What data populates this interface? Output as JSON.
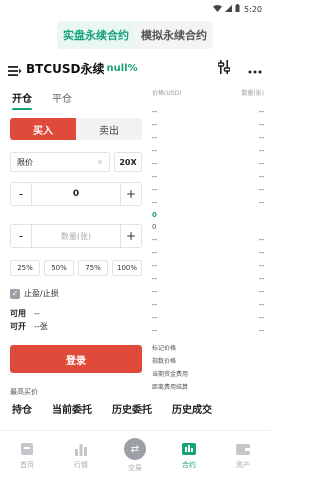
{
  "status": {
    "time": "5:20"
  },
  "top_switch": {
    "live": "实盘永续合约",
    "sim": "模拟永续合约"
  },
  "header": {
    "title": "BTCUSD永续",
    "change": "null%"
  },
  "tabs": {
    "open": "开仓",
    "close": "平仓"
  },
  "buysell": {
    "buy": "买入",
    "sell": "卖出"
  },
  "order_type": "限价",
  "order_type_x": "×",
  "leverage": "20X",
  "price": {
    "minus": "-",
    "value": "0",
    "plus": "+"
  },
  "qty": {
    "minus": "-",
    "placeholder": "数量(张)",
    "plus": "+"
  },
  "percents": [
    "25%",
    "50%",
    "75%",
    "100%"
  ],
  "stoploss_label": "止盈/止损",
  "available": {
    "label": "可用",
    "value": "--"
  },
  "open_qty": {
    "label": "可开",
    "value": "--张"
  },
  "login_label": "登录",
  "best_label": "最高买价",
  "orderbook": {
    "price_header": "价格(USD)",
    "qty_header": "数量(张)",
    "asks": [
      {
        "p": "--",
        "q": "--"
      },
      {
        "p": "--",
        "q": "--"
      },
      {
        "p": "--",
        "q": "--"
      },
      {
        "p": "--",
        "q": "--"
      },
      {
        "p": "--",
        "q": "--"
      },
      {
        "p": "--",
        "q": "--"
      },
      {
        "p": "--",
        "q": "--"
      },
      {
        "p": "--",
        "q": "--"
      }
    ],
    "last_price": "0",
    "mark_small": "0",
    "bids": [
      {
        "p": "--",
        "q": "--"
      },
      {
        "p": "--",
        "q": "--"
      },
      {
        "p": "--",
        "q": "--"
      },
      {
        "p": "--",
        "q": "--"
      },
      {
        "p": "--",
        "q": "--"
      },
      {
        "p": "--",
        "q": "--"
      },
      {
        "p": "--",
        "q": "--"
      },
      {
        "p": "--",
        "q": "--"
      }
    ],
    "info": [
      "标记价格",
      "指数价格",
      "当期资金费用",
      "距离费用结算"
    ]
  },
  "order_tabs": [
    "持仓",
    "当前委托",
    "历史委托",
    "历史成交"
  ],
  "bottom_nav": [
    "首页",
    "行情",
    "交易",
    "合约",
    "资产"
  ],
  "colors": {
    "accent": "#16a37a",
    "buy": "#e04a3a"
  }
}
